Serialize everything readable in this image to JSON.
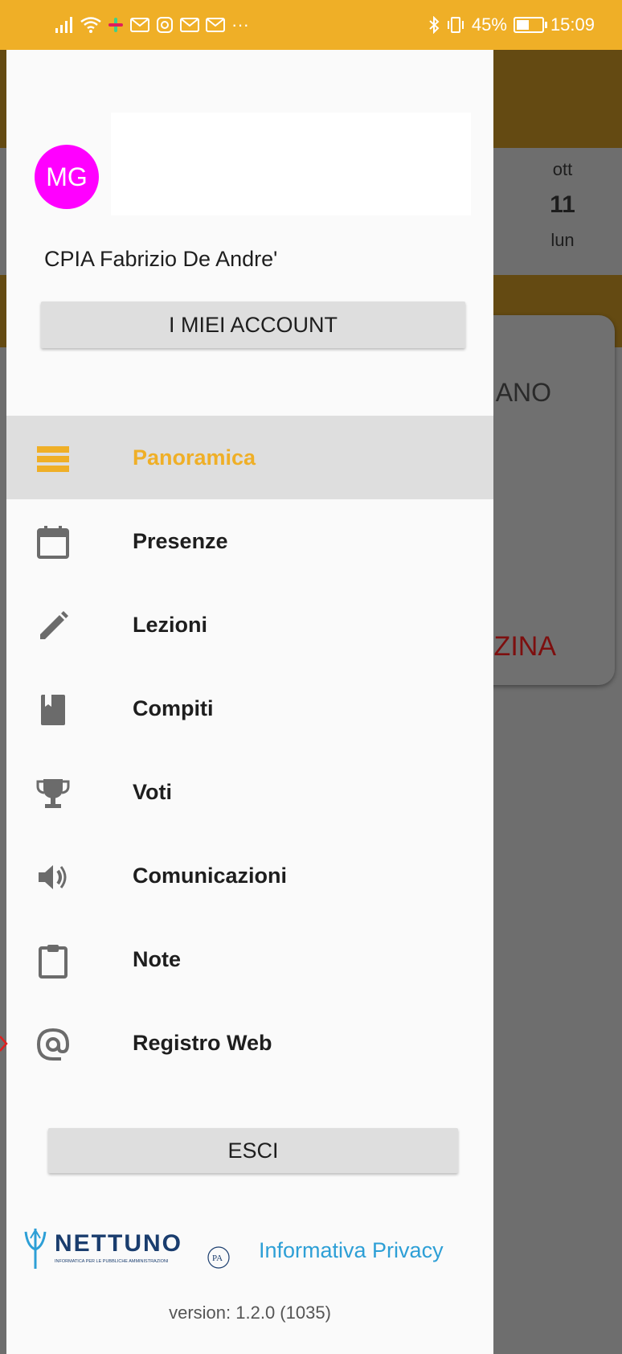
{
  "status_bar": {
    "left_icons": [
      "signal-icon",
      "wifi-icon",
      "slack-icon",
      "gmail-icon",
      "instagram-icon",
      "gmail-icon",
      "gmail-icon"
    ],
    "more": "···",
    "battery_percent": "45%",
    "time": "15:09"
  },
  "background": {
    "date_month": "ott",
    "date_day": "11",
    "date_weekday": "lun",
    "card_text_top": "LIANO",
    "card_text_bottom": "NZINA"
  },
  "drawer": {
    "avatar_initials": "MG",
    "school_name": "CPIA Fabrizio De Andre'",
    "accounts_button": "I MIEI ACCOUNT",
    "menu": [
      {
        "label": "Panoramica",
        "icon": "overview-icon",
        "active": true
      },
      {
        "label": "Presenze",
        "icon": "calendar-icon",
        "active": false
      },
      {
        "label": "Lezioni",
        "icon": "pencil-icon",
        "active": false
      },
      {
        "label": "Compiti",
        "icon": "book-icon",
        "active": false
      },
      {
        "label": "Voti",
        "icon": "trophy-icon",
        "active": false
      },
      {
        "label": "Comunicazioni",
        "icon": "speaker-icon",
        "active": false
      },
      {
        "label": "Note",
        "icon": "clipboard-icon",
        "active": false
      },
      {
        "label": "Registro Web",
        "icon": "at-icon",
        "active": false
      }
    ],
    "logout_button": "ESCI",
    "logo_name": "NETTUNO",
    "logo_tagline": "INFORMATICA PER LE PUBBLICHE AMMINISTRAZIONI",
    "logo_badge": "PA",
    "privacy_link": "Informativa Privacy",
    "version": "version: 1.2.0 (1035)"
  },
  "colors": {
    "accent": "#efaf27",
    "avatar": "#ff00ff",
    "link": "#2d9fd6",
    "icon_grey": "#6b6b6b"
  }
}
